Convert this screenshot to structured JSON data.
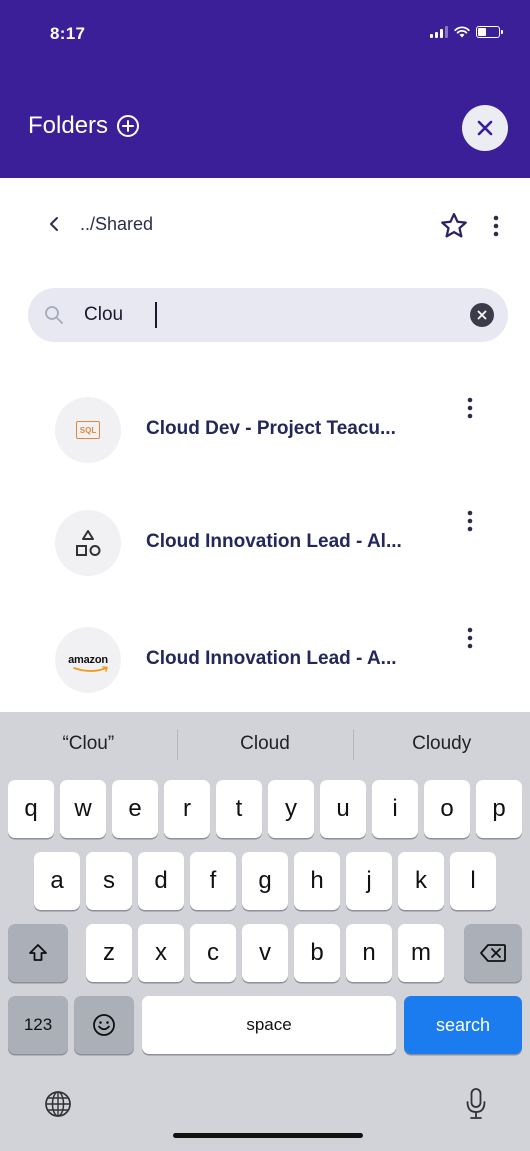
{
  "status_bar": {
    "time": "8:17"
  },
  "header": {
    "title": "Folders"
  },
  "breadcrumb": {
    "path": "../Shared"
  },
  "search": {
    "value": "Clou",
    "placeholder": ""
  },
  "results": [
    {
      "title": "Cloud Dev - Project Teacu...",
      "icon": "sql-icon",
      "icon_text": "SQL"
    },
    {
      "title": "Cloud Innovation Lead - Al...",
      "icon": "shapes-icon"
    },
    {
      "title": "Cloud Innovation Lead - A...",
      "icon": "amazon-logo",
      "icon_text": "amazon"
    }
  ],
  "keyboard": {
    "suggestions": [
      "“Clou”",
      "Cloud",
      "Cloudy"
    ],
    "row1": [
      "q",
      "w",
      "e",
      "r",
      "t",
      "y",
      "u",
      "i",
      "o",
      "p"
    ],
    "row2": [
      "a",
      "s",
      "d",
      "f",
      "g",
      "h",
      "j",
      "k",
      "l"
    ],
    "row3": [
      "z",
      "x",
      "c",
      "v",
      "b",
      "n",
      "m"
    ],
    "numbers_label": "123",
    "space_label": "space",
    "search_label": "search"
  },
  "colors": {
    "header_bg": "#3a1f98",
    "accent_text": "#23285a",
    "search_key": "#1b7cf0"
  }
}
